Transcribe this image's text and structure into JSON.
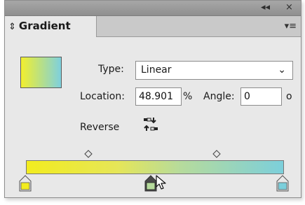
{
  "titlebar": {
    "collapse_glyph": "◂◂",
    "close_glyph": "×"
  },
  "tab": {
    "icon_glyph": "⇕",
    "title": "Gradient"
  },
  "panel_menu_glyph": "▾≡",
  "type": {
    "label": "Type:",
    "value": "Linear",
    "chevron": "⌄"
  },
  "location": {
    "label": "Location:",
    "value": "48.901",
    "unit": "%"
  },
  "angle": {
    "label": "Angle:",
    "value": "0",
    "unit": "o"
  },
  "reverse": {
    "label": "Reverse"
  },
  "gradient": {
    "colors": [
      "#f2ec1f",
      "#7ccfdb"
    ],
    "stops": [
      {
        "location_pct": 0,
        "color": "#f2ec1f"
      },
      {
        "location_pct": 48.901,
        "color": "#b6db9c"
      },
      {
        "location_pct": 100,
        "color": "#7ccfdb"
      }
    ],
    "midpoints_pct": [
      25,
      75
    ]
  },
  "icons": {
    "collapse": "double-left-arrow-icon",
    "close": "close-icon",
    "updown": "up-down-arrows-icon",
    "menu": "panel-menu-icon",
    "reverse": "reverse-gradient-icon",
    "cursor": "mouse-pointer-icon"
  }
}
